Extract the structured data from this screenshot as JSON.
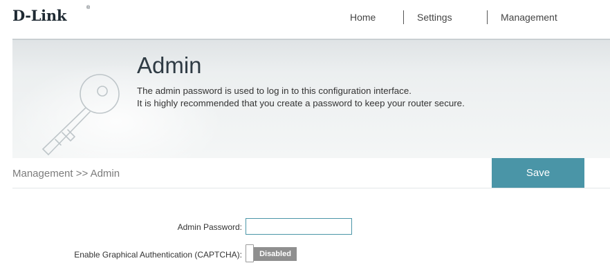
{
  "brand": {
    "logo_text": "D-Link",
    "logo_mark": "®"
  },
  "nav": {
    "home": "Home",
    "settings": "Settings",
    "management": "Management"
  },
  "banner": {
    "title": "Admin",
    "description_line1": "The admin password is used to log in to this configuration interface.",
    "description_line2": "It is highly recommended that you create a password to keep your router secure."
  },
  "breadcrumb": {
    "text": "Management >> Admin"
  },
  "toolbar": {
    "save_label": "Save"
  },
  "form": {
    "admin_password": {
      "label": "Admin Password:",
      "value": ""
    },
    "captcha": {
      "label": "Enable Graphical Authentication (CAPTCHA):",
      "state": "Disabled"
    }
  },
  "colors": {
    "accent": "#4a95a7",
    "toggle_off": "#8f8f8f",
    "banner_bg": "#eceff0"
  },
  "icons": {
    "banner_icon": "key-icon"
  }
}
